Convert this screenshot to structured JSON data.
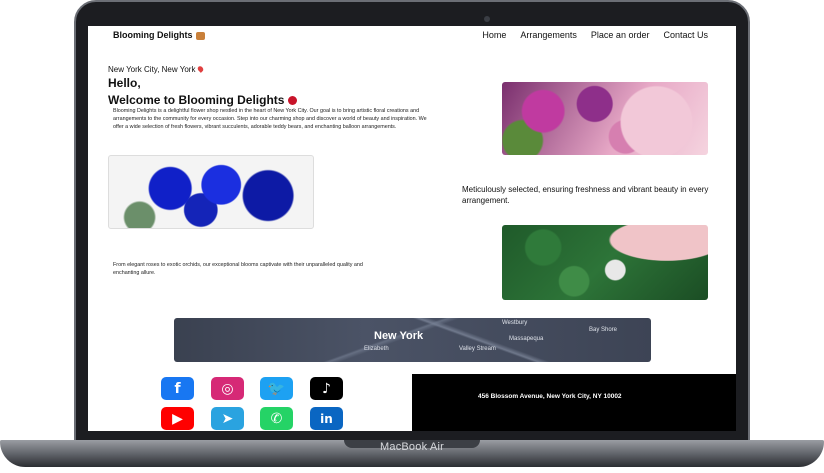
{
  "device": {
    "label": "MacBook Air"
  },
  "site": {
    "brand": "Blooming Delights",
    "nav": [
      "Home",
      "Arrangements",
      "Place an order",
      "Contact Us"
    ],
    "location": "New York City, New York",
    "greeting": "Hello,",
    "welcome": "Welcome to Blooming Delights",
    "intro": "Blooming Delights is a delightful flower shop nestled in the heart of New York City. Our goal is to bring artistic floral creations and arrangements to the community for every occasion. Step into our charming shop and discover a world of beauty and inspiration. We offer a wide selection of fresh flowers, vibrant succulents, adorable teddy bears, and enchanting balloon arrangements.",
    "tagline": "Meticulously selected, ensuring freshness and vibrant beauty in every arrangement.",
    "blooms_text": "From elegant roses to exotic orchids, our exceptional blooms captivate with their unparalleled quality and enchanting allure.",
    "map": {
      "city": "New York",
      "labels": [
        "Westbury",
        "Bay Shore",
        "Massapequa",
        "Valley Stream",
        "Elizabeth"
      ]
    },
    "footer": {
      "address": "456 Blossom Avenue, New York City, NY 10002",
      "social": [
        {
          "icon": "facebook-icon",
          "glyph": "f",
          "color": "#1877f2"
        },
        {
          "icon": "instagram-icon",
          "glyph": "◎",
          "color": "#d62976"
        },
        {
          "icon": "twitter-icon",
          "glyph": "🐦",
          "color": "#1da1f2"
        },
        {
          "icon": "tiktok-icon",
          "glyph": "♪",
          "color": "#000000"
        },
        {
          "icon": "youtube-icon",
          "glyph": "▶",
          "color": "#ff0000"
        },
        {
          "icon": "telegram-icon",
          "glyph": "➤",
          "color": "#2aa3e0"
        },
        {
          "icon": "whatsapp-icon",
          "glyph": "✆",
          "color": "#25d366"
        },
        {
          "icon": "linkedin-icon",
          "glyph": "in",
          "color": "#0a66c2"
        }
      ]
    }
  }
}
